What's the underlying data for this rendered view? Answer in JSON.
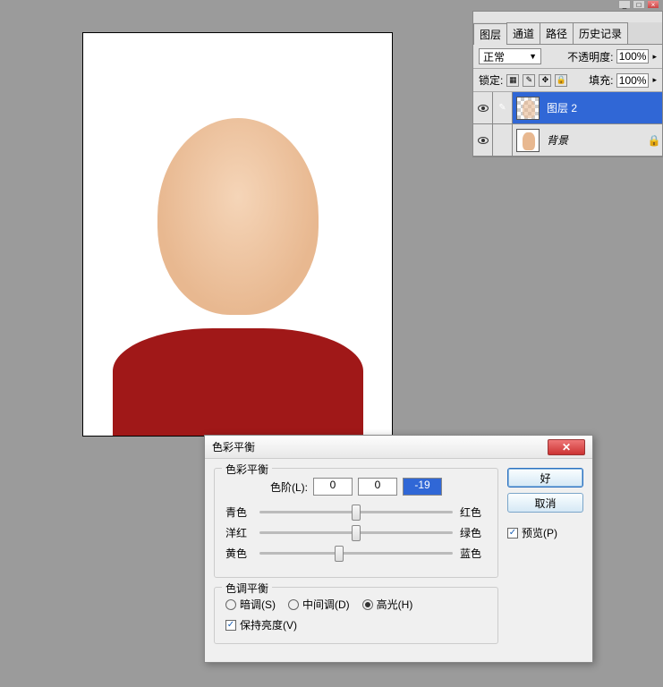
{
  "layers_panel": {
    "tabs": [
      "图层",
      "通道",
      "路径",
      "历史记录"
    ],
    "active_tab": 0,
    "blend_mode": "正常",
    "opacity_label": "不透明度:",
    "opacity_value": "100%",
    "lock_label": "锁定:",
    "fill_label": "填充:",
    "fill_value": "100%",
    "layers": [
      {
        "name": "图层 2",
        "visible": true,
        "selected": true,
        "editing": true,
        "locked": false
      },
      {
        "name": "背景",
        "visible": true,
        "selected": false,
        "editing": false,
        "locked": true
      }
    ]
  },
  "dialog": {
    "title": "色彩平衡",
    "ok": "好",
    "cancel": "取消",
    "preview_label": "预览(P)",
    "preview_checked": true,
    "group1_title": "色彩平衡",
    "levels_label": "色阶(L):",
    "levels": [
      "0",
      "0",
      "-19"
    ],
    "selected_level_index": 2,
    "sliders": [
      {
        "left": "青色",
        "right": "红色",
        "pos": 50
      },
      {
        "left": "洋红",
        "right": "绿色",
        "pos": 50
      },
      {
        "left": "黄色",
        "right": "蓝色",
        "pos": 41
      }
    ],
    "group2_title": "色调平衡",
    "tone_options": [
      {
        "label": "暗调(S)",
        "checked": false
      },
      {
        "label": "中间调(D)",
        "checked": false
      },
      {
        "label": "高光(H)",
        "checked": true
      }
    ],
    "preserve_label": "保持亮度(V)",
    "preserve_checked": true
  }
}
